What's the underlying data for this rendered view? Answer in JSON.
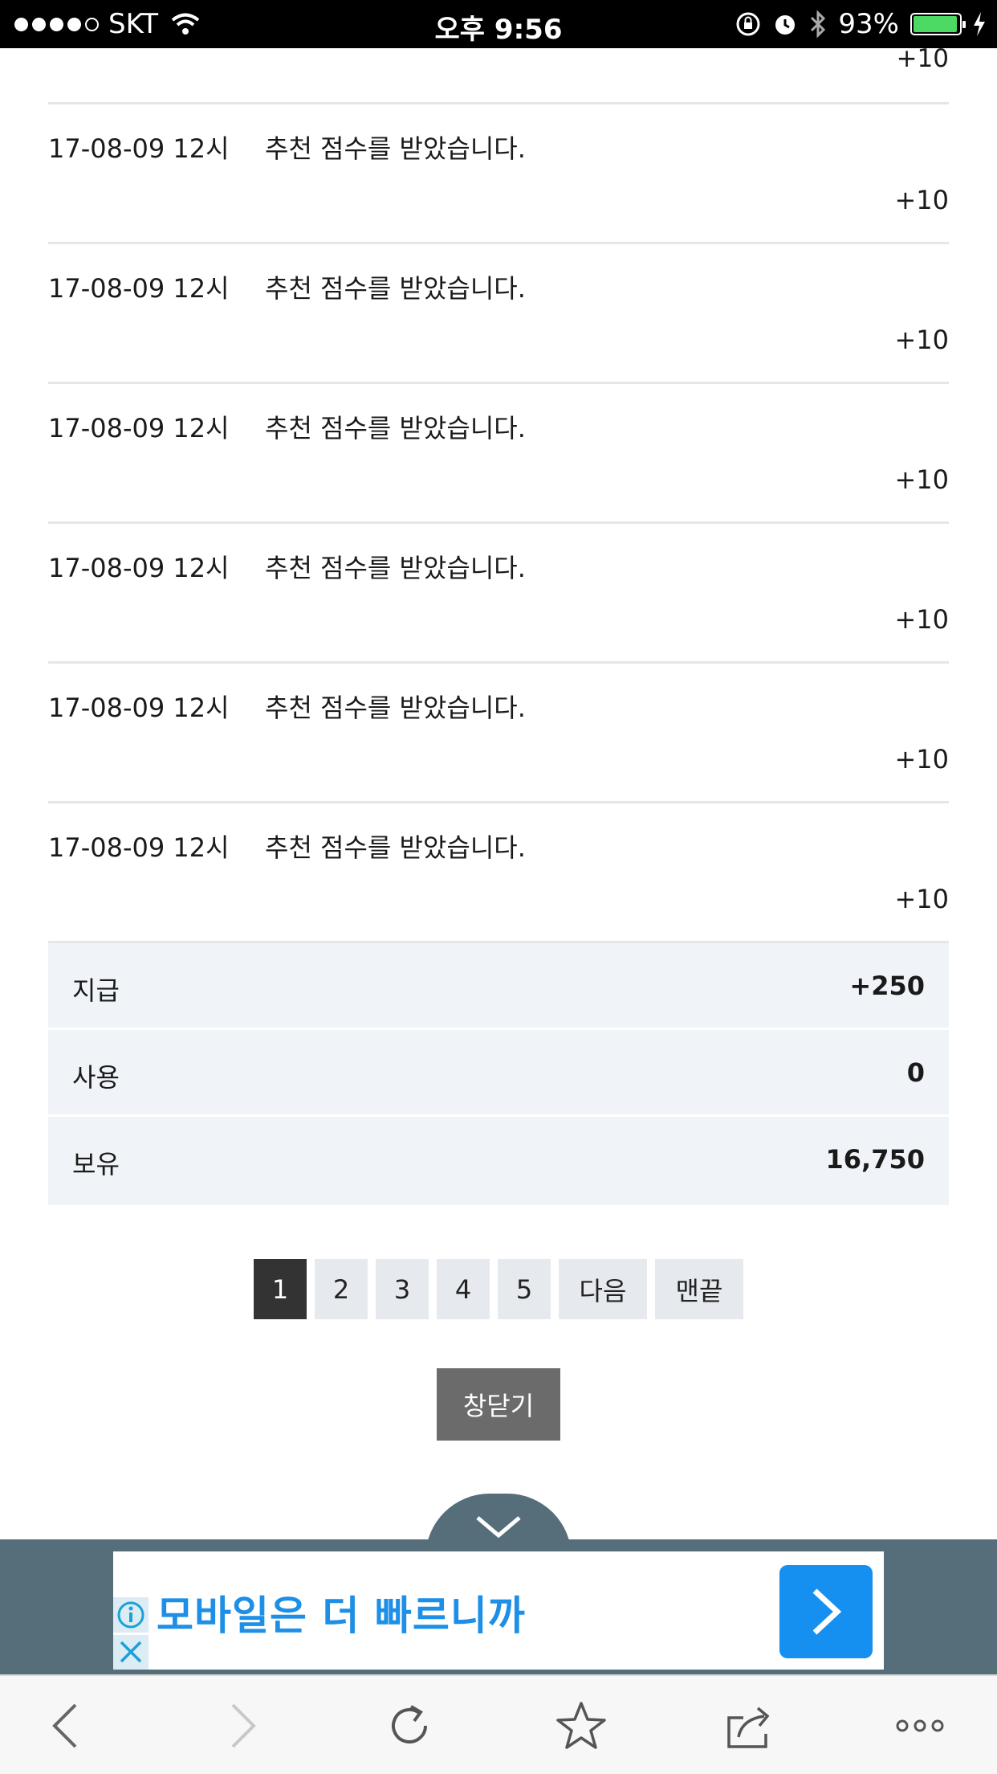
{
  "status_bar": {
    "carrier": "SKT",
    "time": "오후 9:56",
    "battery_percent": "93%"
  },
  "list": {
    "top_partial_points": "+10",
    "rows": [
      {
        "date": "17-08-09 12시",
        "message": "추천 점수를 받았습니다.",
        "points": "+10"
      },
      {
        "date": "17-08-09 12시",
        "message": "추천 점수를 받았습니다.",
        "points": "+10"
      },
      {
        "date": "17-08-09 12시",
        "message": "추천 점수를 받았습니다.",
        "points": "+10"
      },
      {
        "date": "17-08-09 12시",
        "message": "추천 점수를 받았습니다.",
        "points": "+10"
      },
      {
        "date": "17-08-09 12시",
        "message": "추천 점수를 받았습니다.",
        "points": "+10"
      },
      {
        "date": "17-08-09 12시",
        "message": "추천 점수를 받았습니다.",
        "points": "+10"
      }
    ]
  },
  "summary": {
    "given_label": "지급",
    "given_value": "+250",
    "used_label": "사용",
    "used_value": "0",
    "held_label": "보유",
    "held_value": "16,750"
  },
  "pagination": {
    "pages": [
      "1",
      "2",
      "3",
      "4",
      "5"
    ],
    "active_page": "1",
    "next_label": "다음",
    "last_label": "맨끝"
  },
  "close_button_label": "창닫기",
  "ad": {
    "text": "모바일은 더 빠르니까",
    "info_icon": "info-icon",
    "close_icon": "close-icon",
    "arrow_icon": "chevron-right-icon",
    "accent_color": "#1690f0"
  },
  "toolbar": {
    "icons": [
      "back-icon",
      "forward-icon",
      "reload-icon",
      "bookmark-star-icon",
      "share-icon",
      "more-icon"
    ]
  }
}
